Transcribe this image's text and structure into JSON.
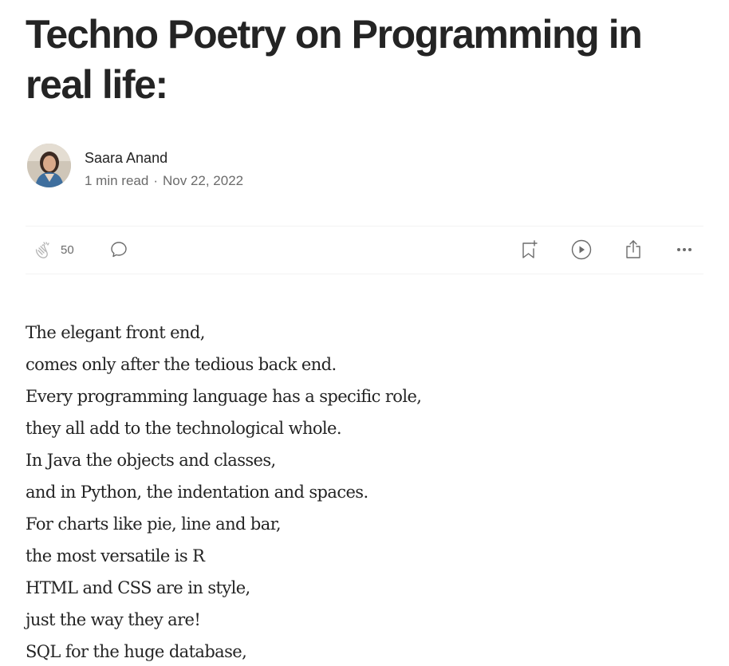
{
  "article": {
    "title": "Techno Poetry on Programming in real life:",
    "author": {
      "name": "Saara Anand",
      "read_time": "1 min read",
      "separator": "·",
      "date": "Nov 22, 2022"
    },
    "actions": {
      "clap_count": "50",
      "icons": [
        "clap-icon",
        "comment-icon",
        "bookmark-add-icon",
        "play-icon",
        "share-icon",
        "more-icon"
      ]
    },
    "body_lines": [
      "The elegant front end,",
      "comes only after the tedious back end.",
      "Every programming language has a specific role,",
      "they all add to the technological whole.",
      "In Java the objects and classes,",
      "and in Python, the indentation and spaces.",
      "For charts like pie, line and bar,",
      "the most versatile is R",
      "HTML and CSS are in style,",
      "just the way they are!",
      "SQL for the huge database,"
    ]
  }
}
